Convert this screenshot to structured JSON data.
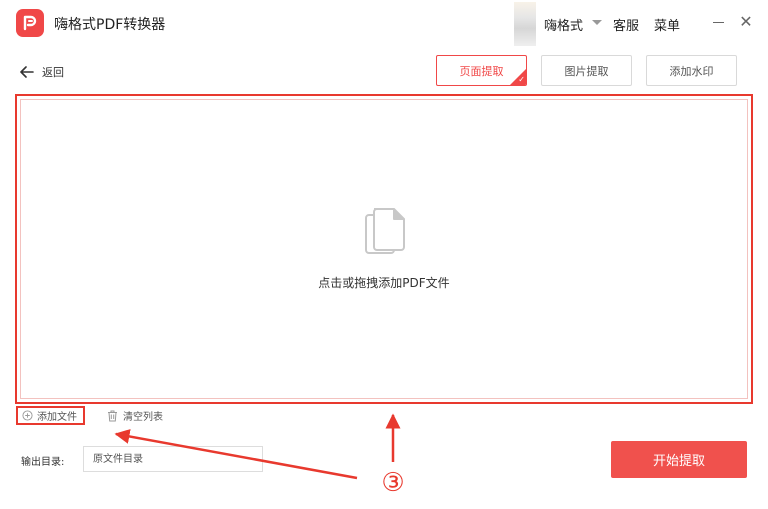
{
  "app": {
    "title": "嗨格式PDF转换器"
  },
  "header": {
    "username": "嗨格式",
    "service": "客服",
    "menu": "菜单"
  },
  "nav": {
    "back_label": "返回"
  },
  "tabs": [
    {
      "label": "页面提取",
      "active": true
    },
    {
      "label": "图片提取",
      "active": false
    },
    {
      "label": "添加水印",
      "active": false
    }
  ],
  "dropzone": {
    "hint": "点击或拖拽添加PDF文件"
  },
  "file_actions": {
    "add_file": "添加文件",
    "clear_list": "清空列表"
  },
  "output": {
    "label": "输出目录:",
    "placeholder": "原文件目录"
  },
  "start_button": {
    "label": "开始提取"
  },
  "annotation": {
    "step": "③"
  },
  "colors": {
    "accent": "#f04848",
    "highlight": "#e8392e",
    "button": "#f0514d"
  },
  "icons": [
    "app-logo-icon",
    "user-avatar",
    "caret-down-icon",
    "minimize-icon",
    "close-icon",
    "back-arrow-icon",
    "check-icon",
    "document-icon",
    "plus-circle-icon",
    "trash-icon"
  ]
}
